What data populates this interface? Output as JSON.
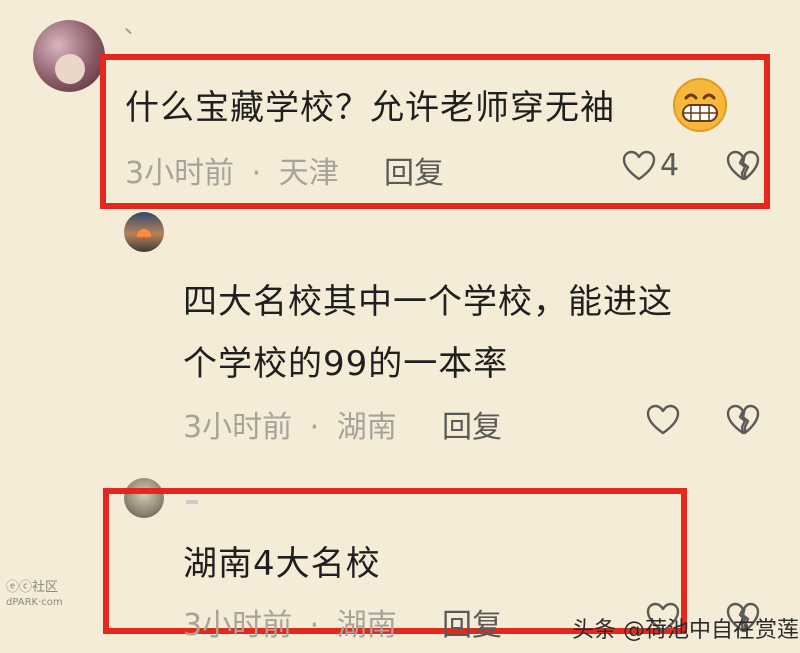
{
  "comments": [
    {
      "text": "什么宝藏学校？允许老师穿无袖",
      "time": "3小时前",
      "sep": "·",
      "location": "天津",
      "reply_label": "回复",
      "like_count": "4"
    },
    {
      "text_line1": "四大名校其中一个学校，能进这",
      "text_line2": "个学校的99的一本率",
      "time": "3小时前",
      "sep": "·",
      "location": "湖南",
      "reply_label": "回复"
    },
    {
      "text": "湖南4大名校",
      "time": "3小时前",
      "sep": "·",
      "location": "湖南",
      "reply_label": "回复"
    }
  ],
  "top_fragment": "、",
  "watermark_left_line1": "ⓔⓒ社区",
  "watermark_left_line2": "dPARK·com",
  "watermark_right": "头条 @荷池中自在赏莲",
  "colors": {
    "background": "#f4ecd7",
    "highlight_box": "#e5281e",
    "meta": "#a7a39a"
  }
}
